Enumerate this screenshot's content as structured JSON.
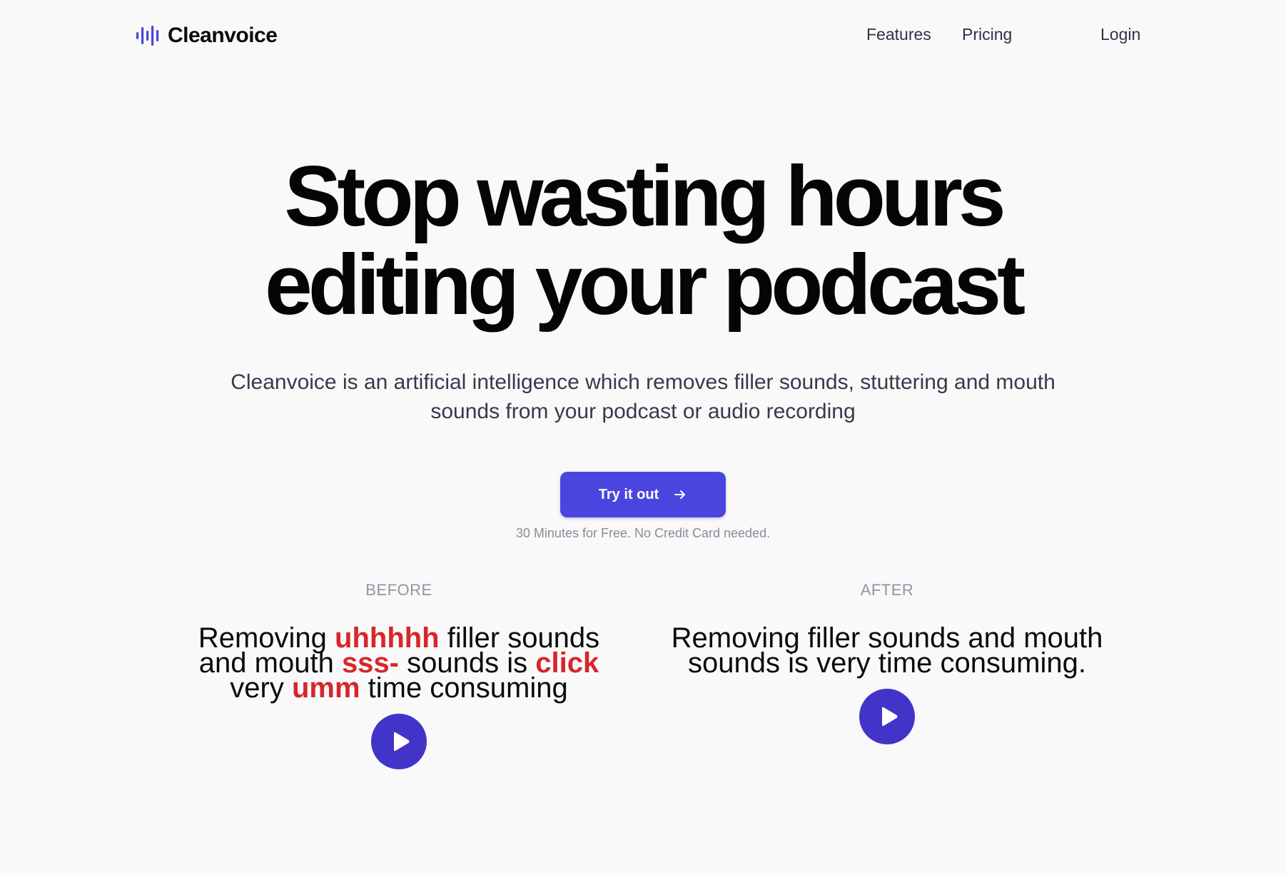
{
  "nav": {
    "logo_text": "Cleanvoice",
    "logo_icon": "waveform-icon",
    "links": [
      {
        "label": "Features"
      },
      {
        "label": "Pricing"
      },
      {
        "label": "Login"
      }
    ]
  },
  "hero": {
    "title_line1": "Stop wasting hours",
    "title_line2": "editing your podcast",
    "subtitle": "Cleanvoice is an artificial intelligence which removes filler sounds, stuttering and mouth sounds from your podcast or audio recording",
    "cta_label": "Try it out",
    "cta_icon": "arrow-right-icon",
    "cta_note": "30 Minutes for Free. No Credit Card needed."
  },
  "comparison": {
    "before": {
      "label": "BEFORE",
      "segments": [
        {
          "text": "Removing ",
          "filler": false
        },
        {
          "text": "uhhhhh",
          "filler": true
        },
        {
          "text": " filler sounds and mouth ",
          "filler": false
        },
        {
          "text": "sss-",
          "filler": true
        },
        {
          "text": " sounds is ",
          "filler": false
        },
        {
          "text": "click",
          "filler": true
        },
        {
          "text": " very ",
          "filler": false
        },
        {
          "text": "umm",
          "filler": true
        },
        {
          "text": " time consuming",
          "filler": false
        }
      ],
      "play_icon": "play-icon"
    },
    "after": {
      "label": "AFTER",
      "text": "Removing filler sounds and mouth sounds is very time consuming.",
      "play_icon": "play-icon"
    }
  },
  "colors": {
    "background": "#f9f9f9",
    "accent": "#4b45e0",
    "play_button": "#4234c9",
    "filler_highlight": "#d7262a",
    "text_primary": "#0b0b0b",
    "text_secondary": "#353b4c",
    "text_muted": "#8f96a3"
  }
}
